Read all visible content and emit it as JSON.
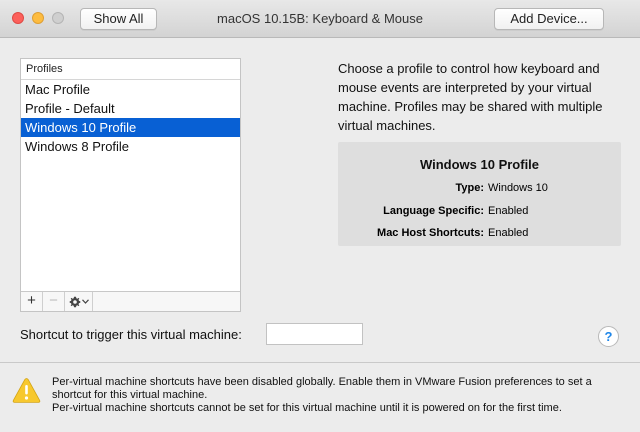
{
  "window": {
    "title": "macOS 10.15B: Keyboard & Mouse",
    "show_all_label": "Show All",
    "add_device_label": "Add Device..."
  },
  "profiles": {
    "header": "Profiles",
    "items": [
      {
        "label": "Mac Profile",
        "selected": false
      },
      {
        "label": "Profile - Default",
        "selected": false
      },
      {
        "label": "Windows 10 Profile",
        "selected": true
      },
      {
        "label": "Windows 8 Profile",
        "selected": false
      }
    ],
    "footer": {
      "add_symbol": "+",
      "remove_symbol": "−",
      "gear_icon": "gear-icon"
    }
  },
  "description": "Choose a profile to control how keyboard and mouse events are interpreted by your virtual machine. Profiles may be shared with multiple virtual machines.",
  "info": {
    "title": "Windows 10 Profile",
    "rows": [
      {
        "label": "Type:",
        "value": "Windows 10"
      },
      {
        "label": "Language Specific:",
        "value": "Enabled"
      },
      {
        "label": "Mac Host Shortcuts:",
        "value": "Enabled"
      }
    ]
  },
  "shortcut": {
    "label": "Shortcut to trigger this virtual machine:",
    "value": ""
  },
  "help": {
    "symbol": "?"
  },
  "warning": {
    "line1": "Per-virtual machine shortcuts have been disabled globally. Enable them in VMware Fusion preferences to set a shortcut for this virtual machine.",
    "line2": "Per-virtual machine shortcuts cannot be set for this virtual machine until it is powered on for the first time."
  },
  "colors": {
    "selection": "#0860d4",
    "close": "#fc605b",
    "minimize": "#fdbc40",
    "zoom_disabled": "#cfcfcf",
    "warning_yellow": "#f7c82e",
    "help_blue": "#1f86e8"
  }
}
